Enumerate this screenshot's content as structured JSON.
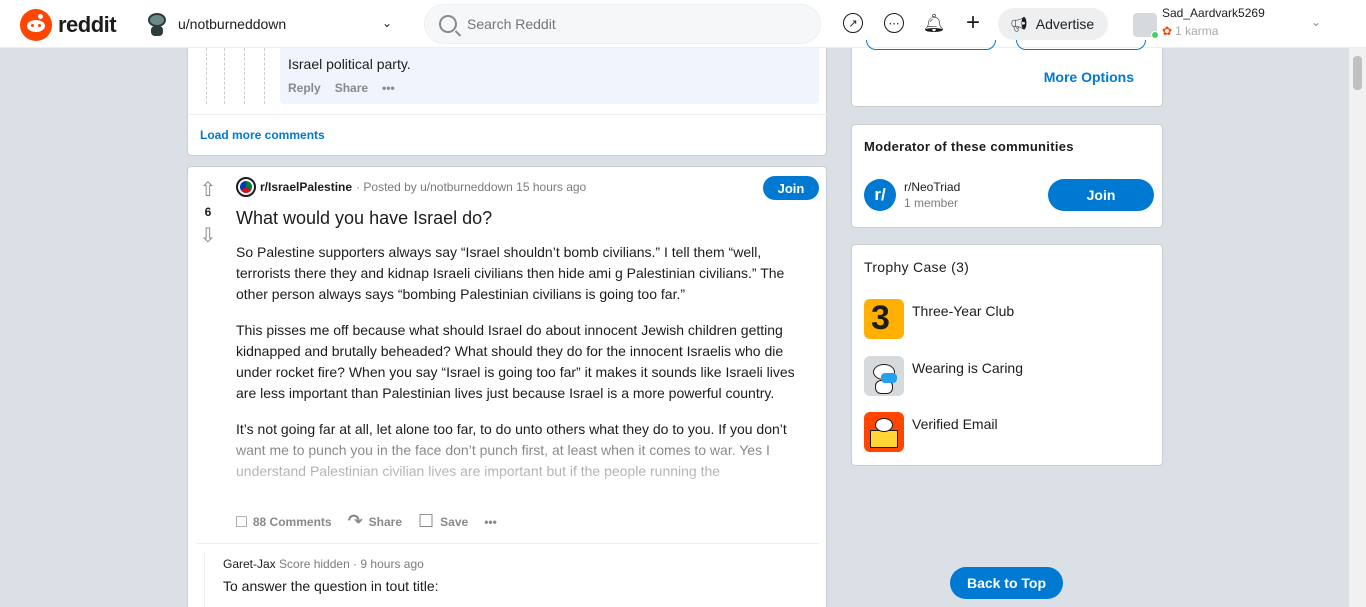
{
  "header": {
    "logo_text": "reddit",
    "feed_user": "u/notburneddown",
    "search_placeholder": "Search Reddit",
    "advertise_label": "Advertise",
    "account": {
      "username": "Sad_Aardvark5269",
      "karma": "1 karma"
    }
  },
  "prev_comment": {
    "text": "Israel political party.",
    "reply_label": "Reply",
    "share_label": "Share",
    "more_label": "•••"
  },
  "load_more_comments": "Load more comments",
  "post": {
    "subreddit": "r/IsraelPalestine",
    "posted_by": "· Posted by u/notburneddown 15 hours ago",
    "join_label": "Join",
    "score": "6",
    "title": "What would you have Israel do?",
    "paragraphs": [
      "So Palestine supporters always say “Israel shouldn’t bomb civilians.” I tell them “well, terrorists there they and kidnap Israeli civilians then hide ami g Palestinian civilians.” The other person always says “bombing Palestinian civilians is going too far.”",
      "This pisses me off because what should Israel do about innocent Jewish children getting kidnapped and brutally beheaded? What should they do for the innocent Israelis who die under rocket fire? When you say “Israel is going too far” it makes it sounds like Israeli lives are less important than Palestinian lives just because Israel is a more powerful country.",
      "It’s not going far at all, let alone too far, to do unto others what they do to you. If you don’t want me to punch you in the face don’t punch first, at least when it comes to war. Yes I understand Palestinian civilian lives are important but if the people running the"
    ],
    "comments_label": "88 Comments",
    "share_label": "Share",
    "save_label": "Save",
    "more_label": "•••"
  },
  "reply": {
    "author": "Garet-Jax",
    "meta": "Score hidden · 9 hours ago",
    "text": "To answer the question in tout title:"
  },
  "sidebar": {
    "more_options": "More Options",
    "moderator_heading": "Moderator of these communities",
    "community_name": "r/NeoTriad",
    "community_members": "1 member",
    "community_icon_text": "r/",
    "join_label": "Join",
    "trophy_heading": "Trophy Case (3)",
    "trophies": [
      {
        "name": "Three-Year Club"
      },
      {
        "name": "Wearing is Caring"
      },
      {
        "name": "Verified Email"
      }
    ]
  },
  "back_to_top": "Back to Top",
  "colors": {
    "brand": "#ff4500",
    "accent": "#0079d3",
    "background": "#dae0e6"
  }
}
